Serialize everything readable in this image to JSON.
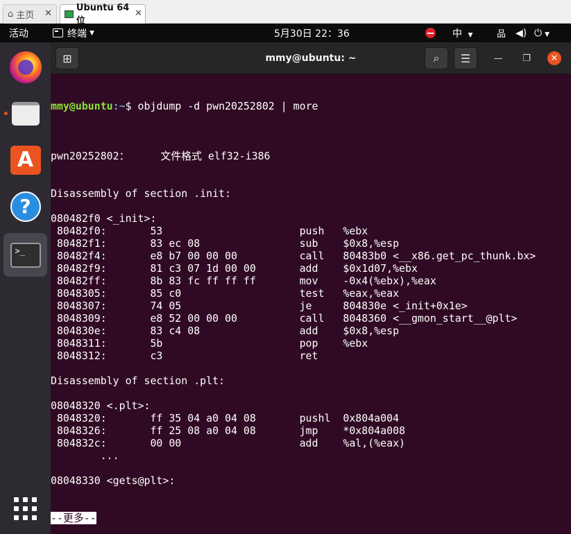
{
  "vm_tabs": [
    {
      "label": "主页",
      "icon": "home-icon"
    },
    {
      "label": "Ubuntu 64 位",
      "icon": "vm-icon"
    }
  ],
  "topbar": {
    "activities": "活动",
    "app_menu": "终端",
    "clock": "5月30日  22：36",
    "input_method": "中"
  },
  "dock": {
    "items": [
      "firefox",
      "files",
      "ubuntu-software",
      "help",
      "terminal"
    ],
    "running": [
      "files",
      "terminal"
    ]
  },
  "terminal": {
    "title": "mmy@ubuntu: ~",
    "prompt_user": "mmy@ubuntu",
    "prompt_path": ":~",
    "prompt_symbol": "$ ",
    "command": "objdump -d pwn20252802 | more",
    "lines": [
      "",
      "pwn20252802：     文件格式 elf32-i386",
      "",
      "",
      "Disassembly of section .init:",
      "",
      "080482f0 <_init>:",
      " 80482f0:       53                      push   %ebx",
      " 80482f1:       83 ec 08                sub    $0x8,%esp",
      " 80482f4:       e8 b7 00 00 00          call   80483b0 <__x86.get_pc_thunk.bx>",
      " 80482f9:       81 c3 07 1d 00 00       add    $0x1d07,%ebx",
      " 80482ff:       8b 83 fc ff ff ff       mov    -0x4(%ebx),%eax",
      " 8048305:       85 c0                   test   %eax,%eax",
      " 8048307:       74 05                   je     804830e <_init+0x1e>",
      " 8048309:       e8 52 00 00 00          call   8048360 <__gmon_start__@plt>",
      " 804830e:       83 c4 08                add    $0x8,%esp",
      " 8048311:       5b                      pop    %ebx",
      " 8048312:       c3                      ret",
      "",
      "Disassembly of section .plt:",
      "",
      "08048320 <.plt>:",
      " 8048320:       ff 35 04 a0 04 08       pushl  0x804a004",
      " 8048326:       ff 25 08 a0 04 08       jmp    *0x804a008",
      " 804832c:       00 00                   add    %al,(%eax)",
      "        ...",
      "",
      "08048330 <gets@plt>:"
    ],
    "more_prompt": "--更多--"
  },
  "colors": {
    "terminal_bg": "#300a24",
    "prompt_user": "#8ae234",
    "prompt_path": "#729fcf",
    "accent": "#e95420"
  }
}
